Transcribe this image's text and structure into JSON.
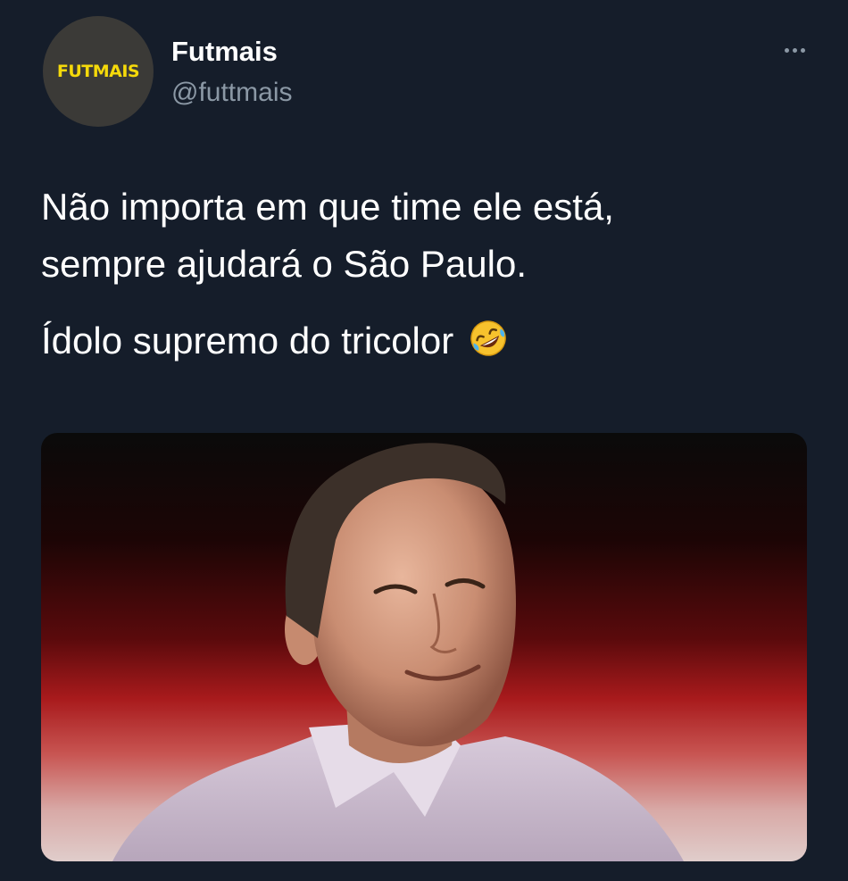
{
  "author": {
    "avatar_text": "FUTMAIS",
    "avatar_text_color": "#f5d90a",
    "avatar_bg": "#3b3a37",
    "display_name": "Futmais",
    "handle": "@futtmais"
  },
  "actions": {
    "more_icon": "more-horizontal-icon"
  },
  "tweet": {
    "line1": "Não importa em que time ele está,",
    "line2": "sempre ajudará o São Paulo.",
    "line3": "Ídolo supremo do tricolor",
    "emoji": "rolling-on-floor-laughing-emoji"
  },
  "media": {
    "type": "photo"
  },
  "colors": {
    "background": "#151d2a",
    "text_primary": "#ffffff",
    "text_secondary": "#8b98a5"
  }
}
